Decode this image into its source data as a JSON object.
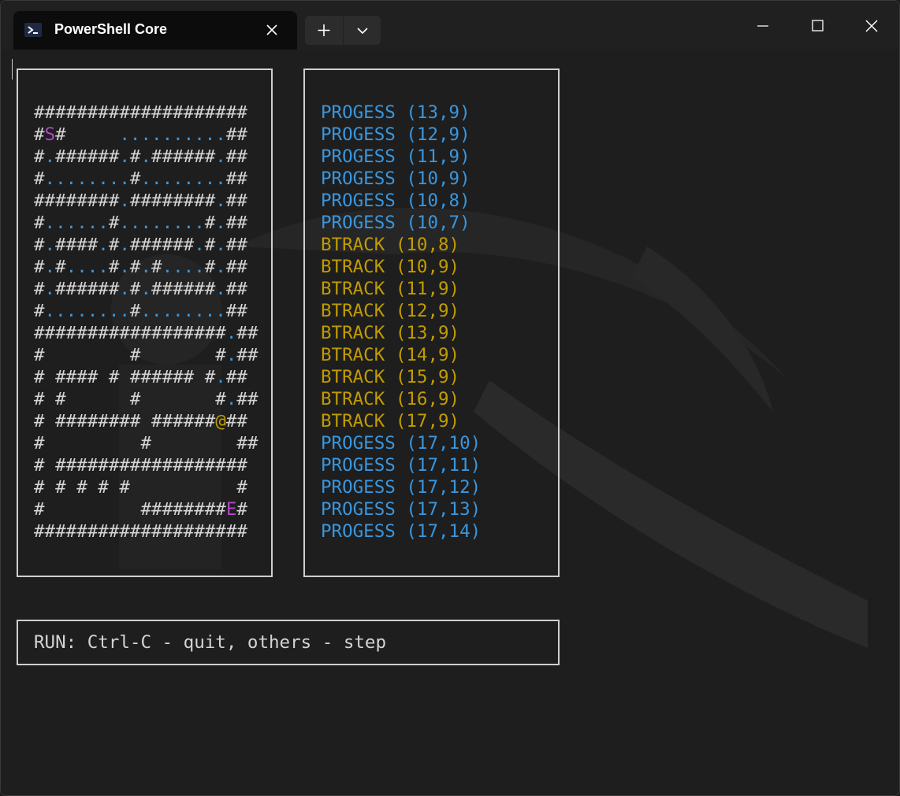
{
  "window": {
    "tab_title": "PowerShell Core",
    "tab_icon": "powershell-icon",
    "new_tab_icon": "plus-icon",
    "dropdown_icon": "chevron-down-icon",
    "minimize_icon": "minimize-icon",
    "maximize_icon": "maximize-icon",
    "close_icon": "close-icon"
  },
  "colors": {
    "wall": "#d4d4d4",
    "path": "#3a96dd",
    "start_end": "#b148c6",
    "current": "#c19c00",
    "progress": "#3a96dd",
    "backtrack": "#c19c00"
  },
  "maze": {
    "rows": [
      "####################",
      "#S#     ..........##",
      "#.######.#.######.##",
      "#........#........##",
      "########.########.##",
      "#......#........#.##",
      "#.####.#.######.#.##",
      "#.#....#.#.#....#.##",
      "#.######.#.######.##",
      "#........#........##",
      "##################.##",
      "#        #       #.##",
      "# #### # ###### #.##",
      "# #      #       #.##",
      "# ######## ######@##",
      "#         #        ##",
      "# ##################",
      "# # # # #          #",
      "#         ########E#",
      "####################"
    ]
  },
  "log": [
    {
      "type": "progress",
      "text": "PROGESS (13,9)"
    },
    {
      "type": "progress",
      "text": "PROGESS (12,9)"
    },
    {
      "type": "progress",
      "text": "PROGESS (11,9)"
    },
    {
      "type": "progress",
      "text": "PROGESS (10,9)"
    },
    {
      "type": "progress",
      "text": "PROGESS (10,8)"
    },
    {
      "type": "progress",
      "text": "PROGESS (10,7)"
    },
    {
      "type": "btrack",
      "text": "BTRACK (10,8)"
    },
    {
      "type": "btrack",
      "text": "BTRACK (10,9)"
    },
    {
      "type": "btrack",
      "text": "BTRACK (11,9)"
    },
    {
      "type": "btrack",
      "text": "BTRACK (12,9)"
    },
    {
      "type": "btrack",
      "text": "BTRACK (13,9)"
    },
    {
      "type": "btrack",
      "text": "BTRACK (14,9)"
    },
    {
      "type": "btrack",
      "text": "BTRACK (15,9)"
    },
    {
      "type": "btrack",
      "text": "BTRACK (16,9)"
    },
    {
      "type": "btrack",
      "text": "BTRACK (17,9)"
    },
    {
      "type": "progress",
      "text": "PROGESS (17,10)"
    },
    {
      "type": "progress",
      "text": "PROGESS (17,11)"
    },
    {
      "type": "progress",
      "text": "PROGESS (17,12)"
    },
    {
      "type": "progress",
      "text": "PROGESS (17,13)"
    },
    {
      "type": "progress",
      "text": "PROGESS (17,14)"
    }
  ],
  "status": {
    "text": "RUN: Ctrl-C - quit, others - step"
  }
}
